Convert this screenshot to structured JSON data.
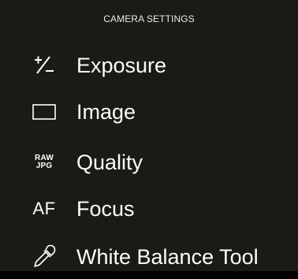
{
  "header": {
    "title": "CAMERA SETTINGS"
  },
  "menu": {
    "items": [
      {
        "label": "Exposure",
        "icon": "exposure-compensation-icon"
      },
      {
        "label": "Image",
        "icon": "image-frame-icon"
      },
      {
        "label": "Quality",
        "icon": "raw-jpg-icon",
        "icon_text": [
          "RAW",
          "JPG"
        ]
      },
      {
        "label": "Focus",
        "icon": "af-icon",
        "icon_text": "AF"
      },
      {
        "label": "White Balance Tool",
        "icon": "eyedropper-icon"
      }
    ]
  },
  "colors": {
    "background": "#1a1a17",
    "text": "#ffffff"
  }
}
